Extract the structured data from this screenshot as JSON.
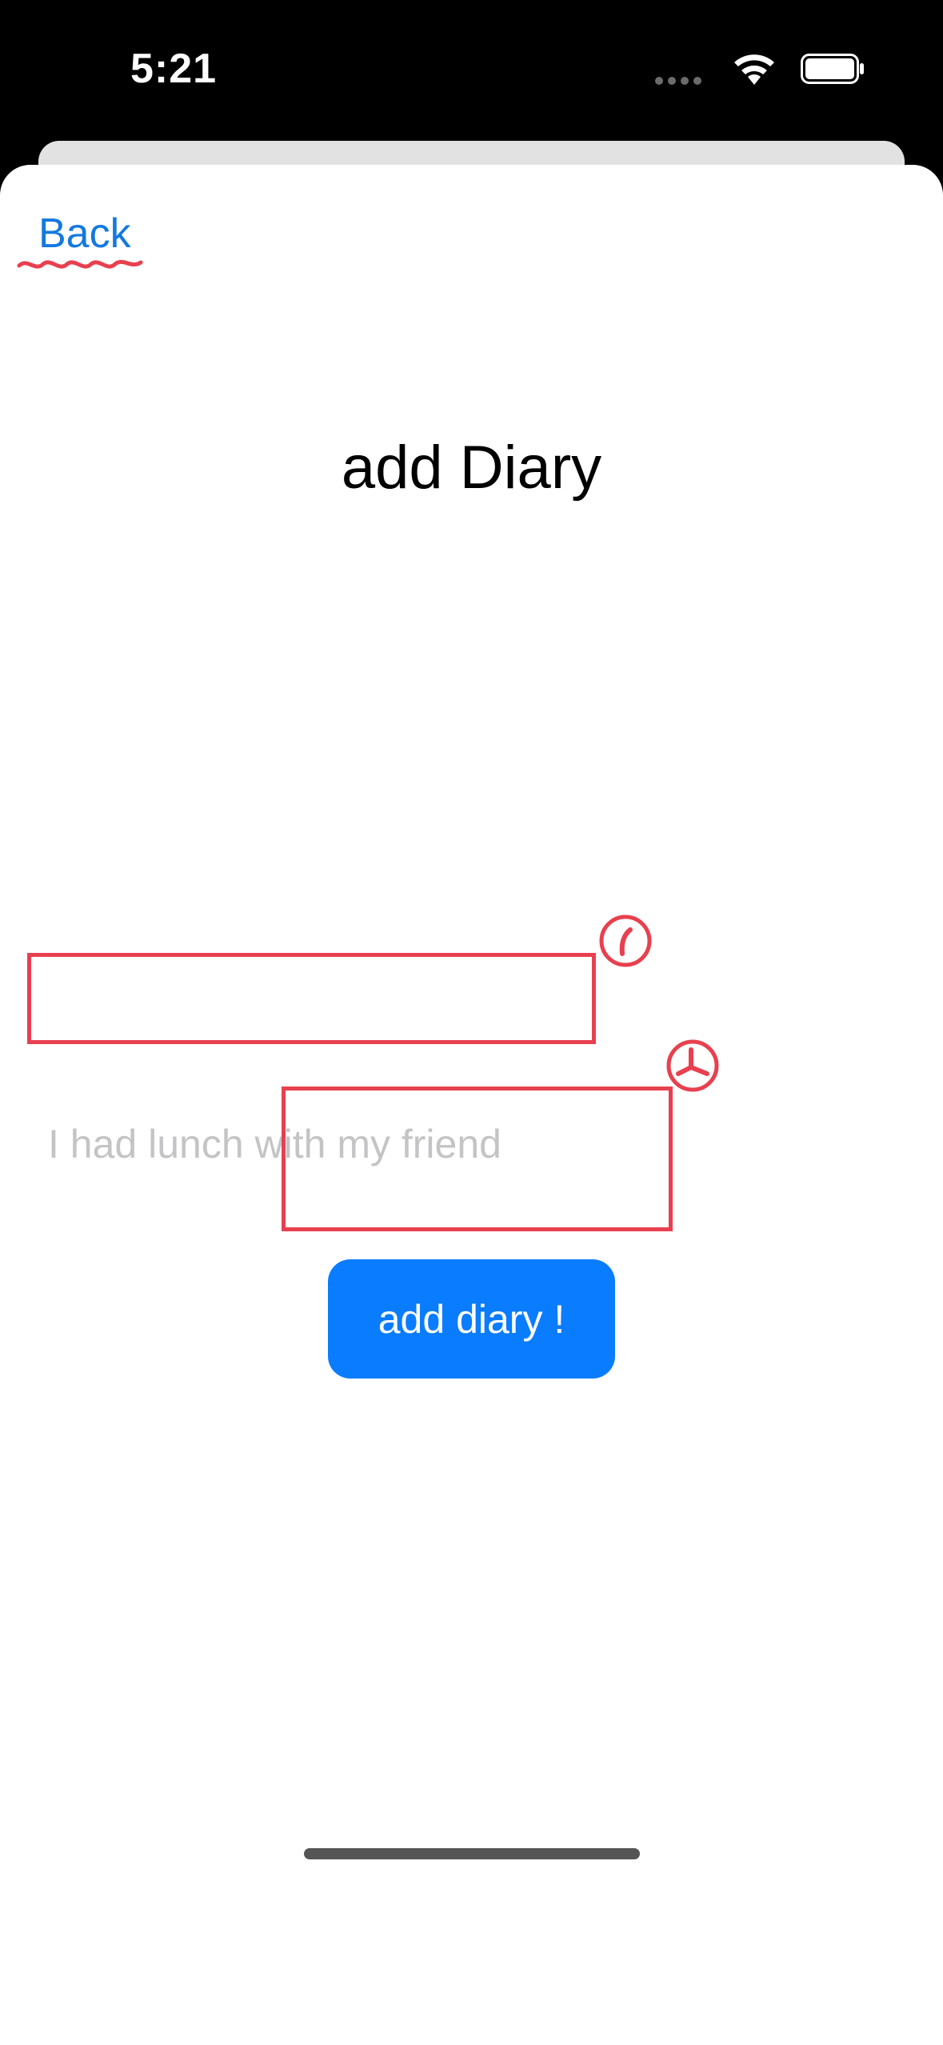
{
  "status_bar": {
    "time": "5:21",
    "icons": [
      "cellular-signal-icon",
      "wifi-icon",
      "battery-icon"
    ]
  },
  "navigation": {
    "back_label": "Back"
  },
  "page": {
    "title": "add Diary"
  },
  "form": {
    "input_value": "",
    "input_placeholder": "I had lunch with my friend",
    "submit_label": "add diary !"
  },
  "colors": {
    "accent": "#1479e0",
    "button_bg": "#0a7cff",
    "annotation": "#e8404f",
    "placeholder": "#c4c4c6"
  }
}
